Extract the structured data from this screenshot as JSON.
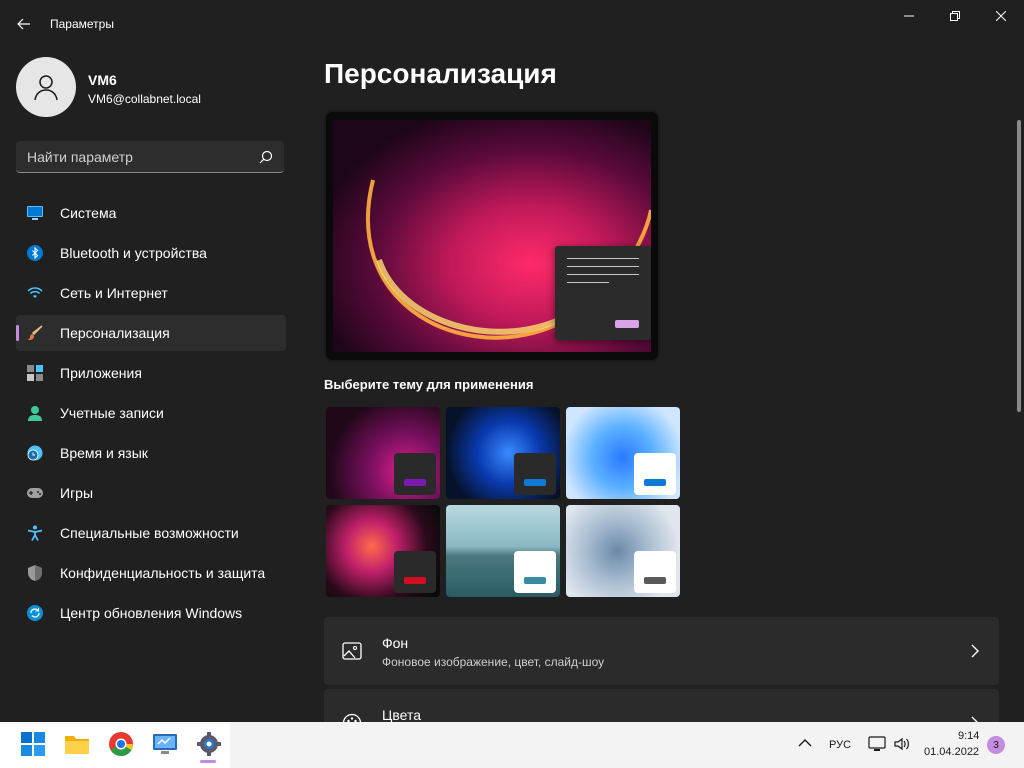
{
  "window": {
    "title": "Параметры"
  },
  "profile": {
    "name": "VM6",
    "email": "VM6@collabnet.local"
  },
  "search": {
    "placeholder": "Найти параметр"
  },
  "nav": {
    "items": [
      {
        "label": "Система",
        "icon": "monitor-icon"
      },
      {
        "label": "Bluetooth и устройства",
        "icon": "bluetooth-icon"
      },
      {
        "label": "Сеть и Интернет",
        "icon": "wifi-icon"
      },
      {
        "label": "Персонализация",
        "icon": "brush-icon",
        "selected": true
      },
      {
        "label": "Приложения",
        "icon": "apps-icon"
      },
      {
        "label": "Учетные записи",
        "icon": "person-icon"
      },
      {
        "label": "Время и язык",
        "icon": "globe-clock-icon"
      },
      {
        "label": "Игры",
        "icon": "gamepad-icon"
      },
      {
        "label": "Специальные возможности",
        "icon": "accessibility-icon"
      },
      {
        "label": "Конфиденциальность и защита",
        "icon": "shield-icon"
      },
      {
        "label": "Центр обновления Windows",
        "icon": "update-icon"
      }
    ]
  },
  "main": {
    "title": "Персонализация",
    "themes_label": "Выберите тему для применения",
    "cards": [
      {
        "title": "Фон",
        "subtitle": "Фоновое изображение, цвет, слайд-шоу",
        "icon": "image-icon"
      },
      {
        "title": "Цвета",
        "subtitle": "",
        "icon": "palette-icon"
      }
    ]
  },
  "colors": {
    "accent": "#c48be0",
    "background": "#202020",
    "card": "#2b2b2b"
  },
  "taskbar": {
    "language": "РУС",
    "time": "9:14",
    "date": "01.04.2022",
    "notifications": "3"
  }
}
